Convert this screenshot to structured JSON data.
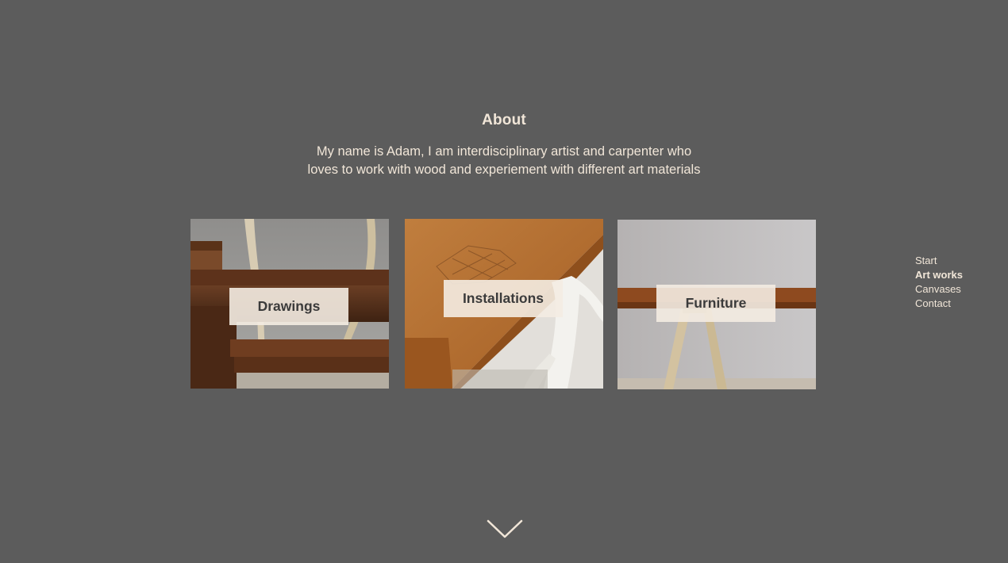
{
  "about": {
    "title": "About",
    "text_line1": "My name is Adam, I am interdisciplinary artist and carpenter who",
    "text_line2": "loves to work with wood and experiement with different art materials"
  },
  "gallery": {
    "cards": [
      {
        "label": "Drawings",
        "image": "wooden-bench-photo"
      },
      {
        "label": "Installations",
        "image": "wooden-table-corner-photo"
      },
      {
        "label": "Furniture",
        "image": "wooden-trestle-table-photo"
      }
    ]
  },
  "nav": {
    "items": [
      {
        "label": "Start",
        "active": false
      },
      {
        "label": "Art works",
        "active": true
      },
      {
        "label": "Canvases",
        "active": false
      },
      {
        "label": "Contact",
        "active": false
      }
    ]
  },
  "scroll": {
    "icon": "chevron-down-icon"
  },
  "colors": {
    "background": "#5c5c5c",
    "text": "#f1e6d8",
    "label_bg": "#f4ece2",
    "label_text": "#3b3b3b"
  }
}
